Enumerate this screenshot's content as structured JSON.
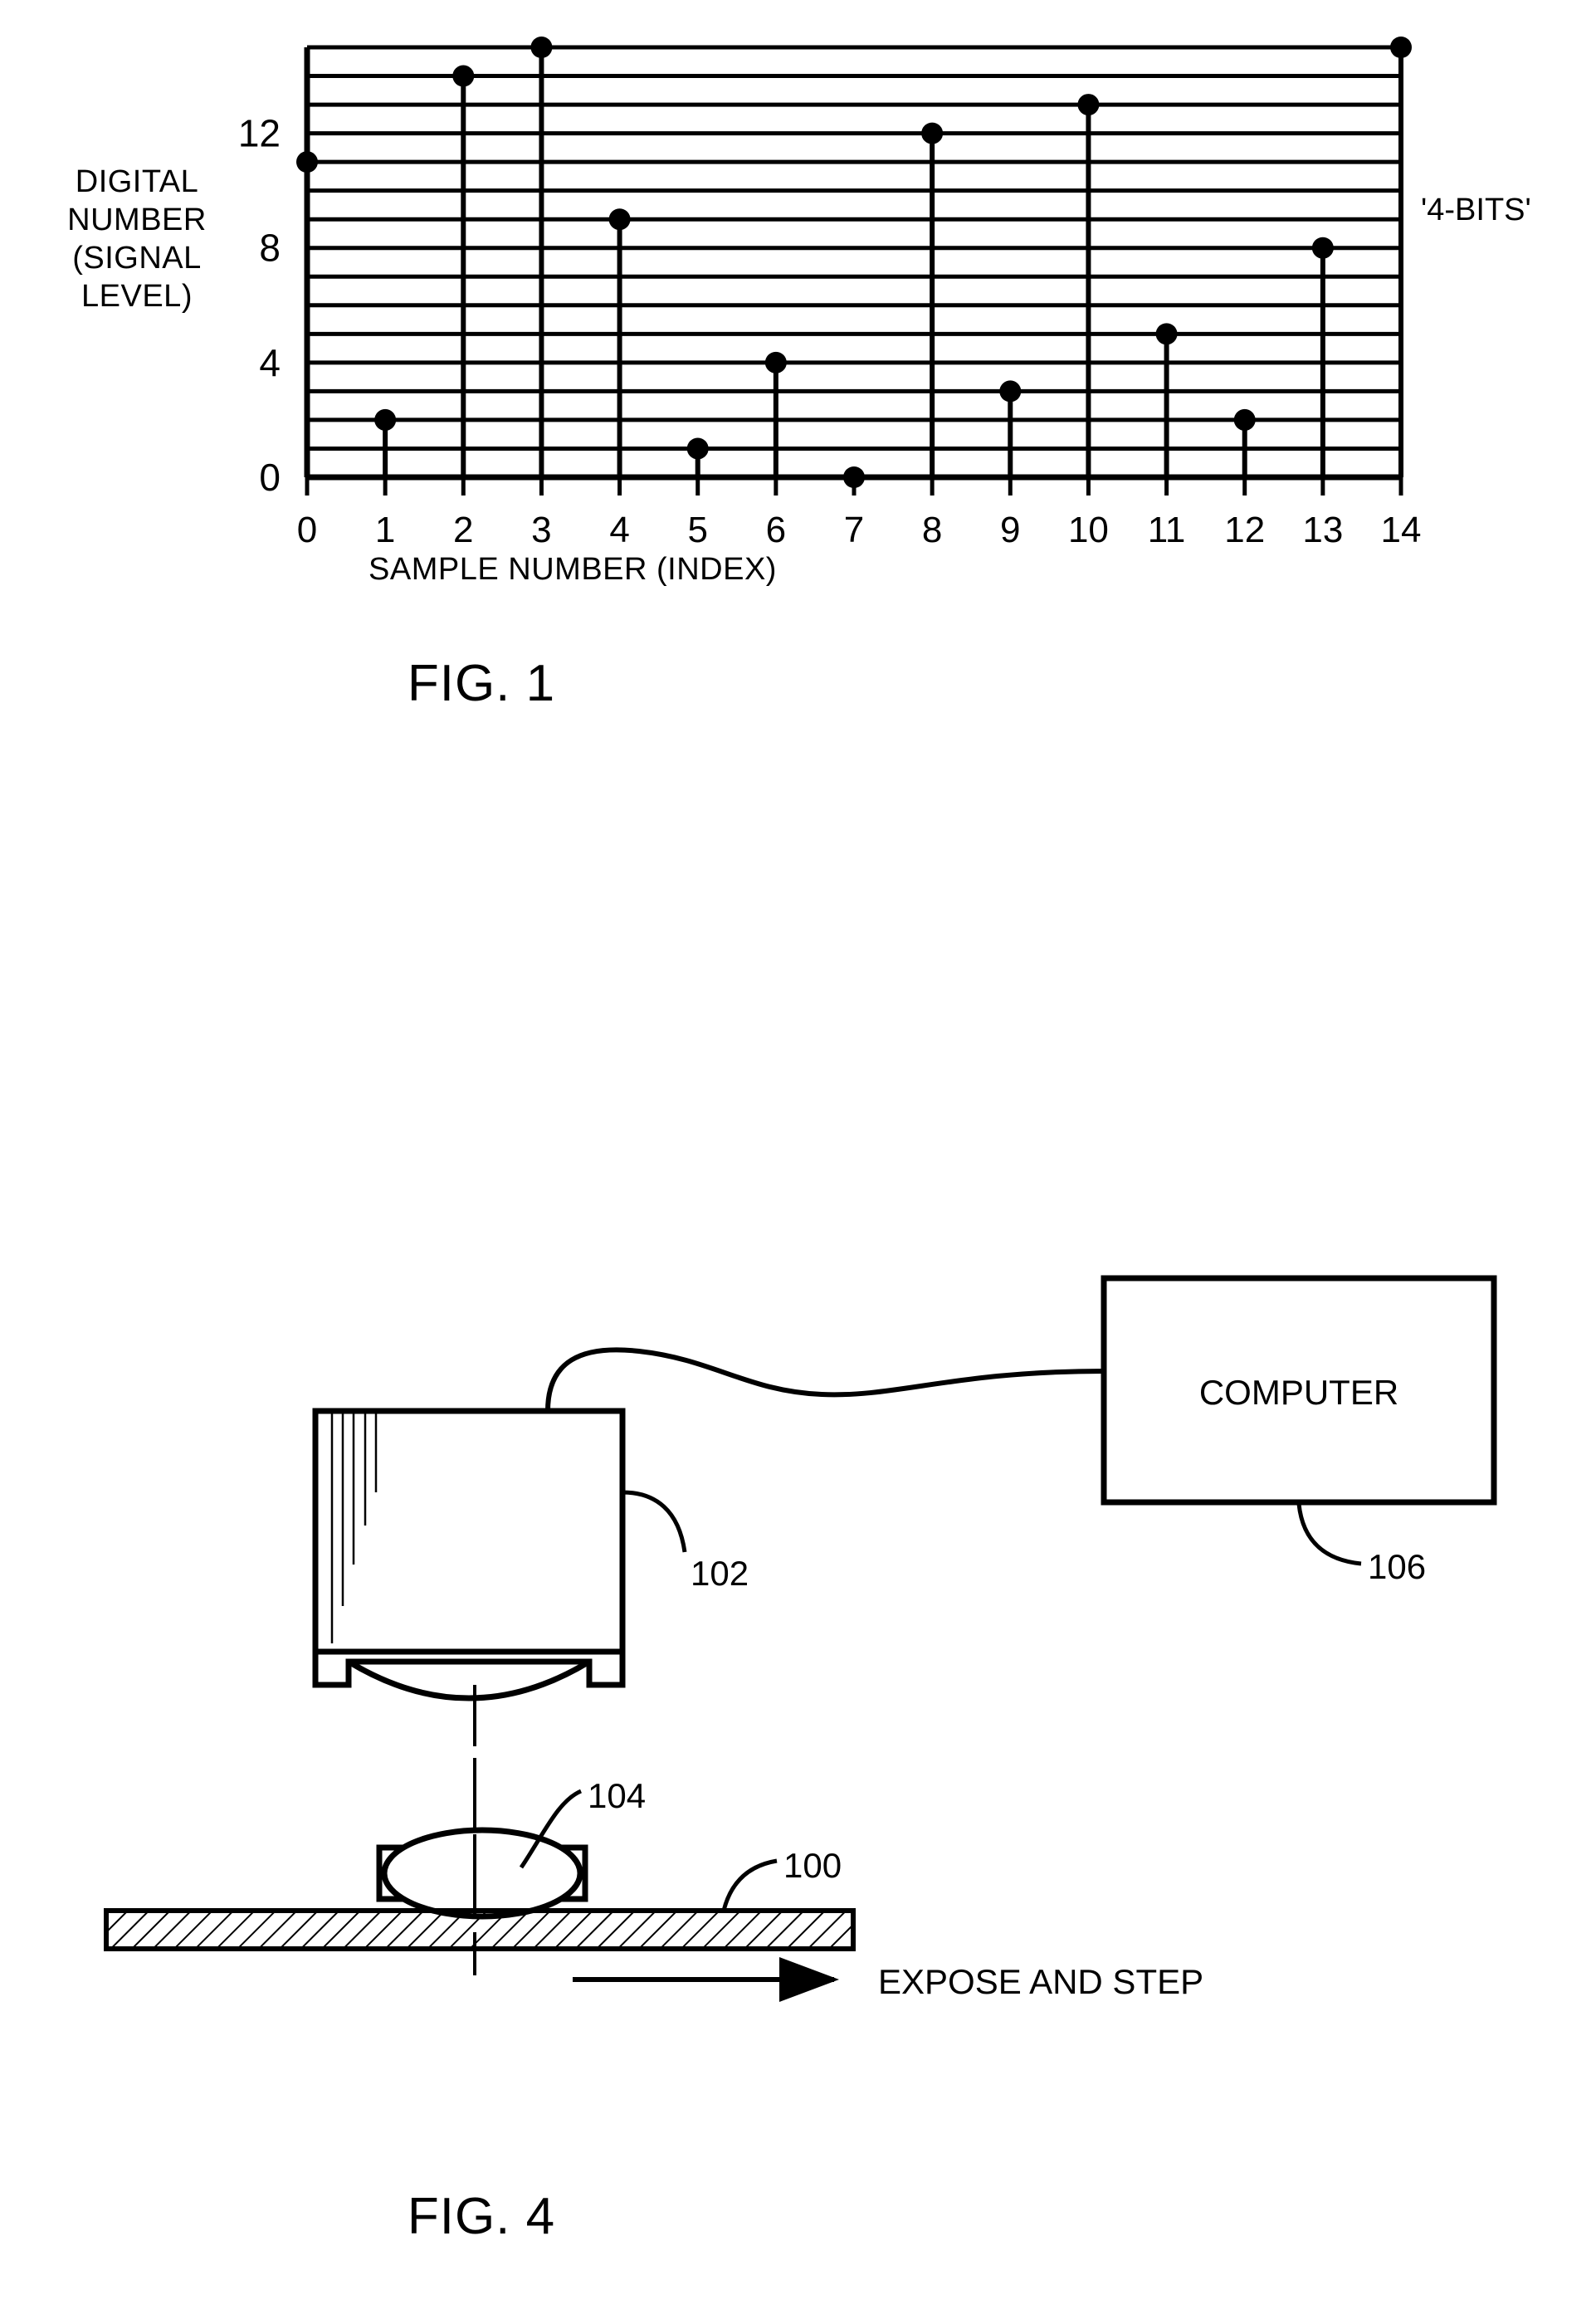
{
  "figure1": {
    "caption": "FIG. 1",
    "annotation": "'4-BITS'",
    "ylabel_lines": [
      "DIGITAL",
      "NUMBER",
      "(SIGNAL",
      "LEVEL)"
    ],
    "xlabel": "SAMPLE NUMBER (INDEX)"
  },
  "chart_data": {
    "type": "scatter",
    "title": "FIG. 1",
    "xlabel": "SAMPLE NUMBER (INDEX)",
    "ylabel": "DIGITAL NUMBER (SIGNAL LEVEL)",
    "annotation": "'4-BITS'",
    "grid": true,
    "legend": "none",
    "xlim": [
      0,
      14
    ],
    "ylim": [
      0,
      15
    ],
    "xticks": [
      "0",
      "1",
      "2",
      "3",
      "4",
      "5",
      "6",
      "7",
      "8",
      "9",
      "10",
      "11",
      "12",
      "13",
      "14"
    ],
    "yticks": [
      "0",
      "4",
      "8",
      "12"
    ],
    "x": [
      0,
      1,
      2,
      3,
      4,
      5,
      6,
      7,
      8,
      9,
      10,
      11,
      12,
      13,
      14
    ],
    "values": [
      11,
      2,
      14,
      15,
      9,
      1,
      4,
      0,
      12,
      3,
      13,
      5,
      2,
      8,
      15
    ],
    "series": [
      {
        "name": "digital number",
        "values": [
          11,
          2,
          14,
          15,
          9,
          1,
          4,
          0,
          12,
          3,
          13,
          5,
          2,
          8,
          15
        ]
      }
    ]
  },
  "figure4": {
    "caption": "FIG. 4",
    "computer_label": "COMPUTER",
    "ref_camera": "102",
    "ref_lens": "104",
    "ref_computer": "106",
    "ref_substrate": "100",
    "motion_label": "EXPOSE AND STEP"
  },
  "colors": {
    "ink": "#000000",
    "paper": "#ffffff"
  }
}
